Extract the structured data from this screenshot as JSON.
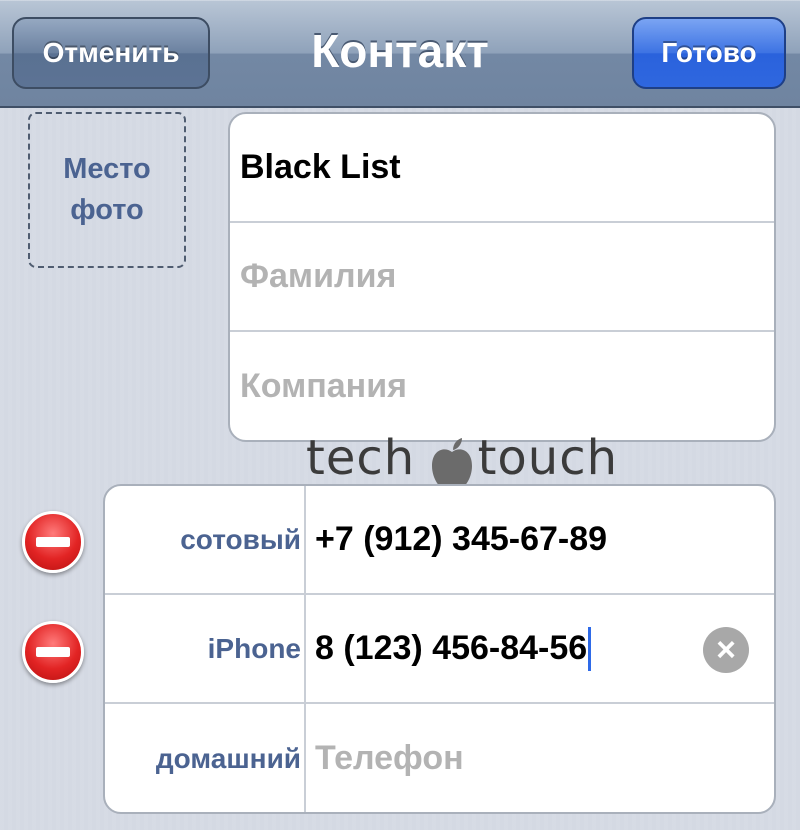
{
  "navbar": {
    "cancel_label": "Отменить",
    "title": "Контакт",
    "done_label": "Готово"
  },
  "photo": {
    "label": "Место\nфото"
  },
  "name_fields": [
    {
      "value": "Black List",
      "placeholder": ""
    },
    {
      "value": "",
      "placeholder": "Фамилия"
    },
    {
      "value": "",
      "placeholder": "Компания"
    }
  ],
  "phones": [
    {
      "label": "сотовый",
      "value": "+7 (912) 345-67-89"
    },
    {
      "label": "iPhone",
      "value": "8 (123) 456-84-56"
    },
    {
      "label": "домашний",
      "placeholder": "Телефон"
    }
  ],
  "watermark": {
    "left": "tech",
    "right": "touch"
  },
  "colors": {
    "accent_blue": "#2f67df",
    "label_blue": "#4b6391",
    "delete_red": "#e22424",
    "cursor": "#2e6ae8"
  },
  "icons": [
    "minus-circle-icon",
    "clear-icon",
    "apple-logo-icon"
  ]
}
